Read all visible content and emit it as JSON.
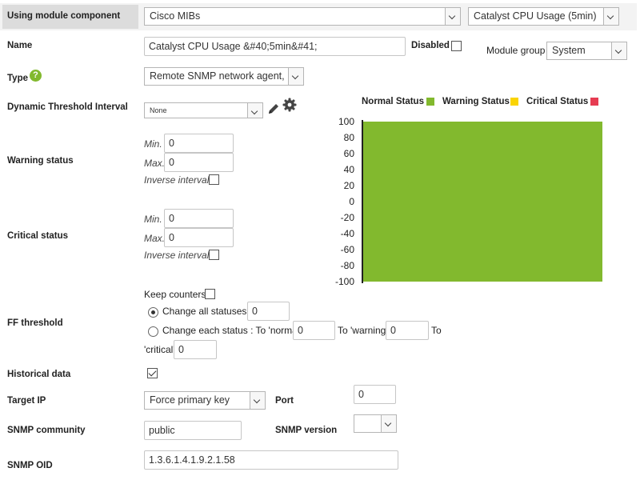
{
  "top": {
    "label": "Using module component",
    "component_group": "Cisco MIBs",
    "component": "Catalyst CPU Usage (5min)"
  },
  "name_row": {
    "label": "Name",
    "value": "Catalyst CPU Usage &#40;5min&#41;",
    "disabled_label": "Disabled",
    "module_group_label": "Module group",
    "module_group_value": "System"
  },
  "type_row": {
    "label": "Type",
    "value": "Remote SNMP network agent,"
  },
  "threshold_row": {
    "label": "Dynamic Threshold Interval",
    "value": "None"
  },
  "warning": {
    "label": "Warning status",
    "min_label": "Min.",
    "min_value": "0",
    "max_label": "Max.",
    "max_value": "0",
    "inverse_label": "Inverse interval"
  },
  "critical": {
    "label": "Critical status",
    "min_label": "Min.",
    "min_value": "0",
    "max_label": "Max.",
    "max_value": "0",
    "inverse_label": "Inverse interval"
  },
  "ff": {
    "label": "FF threshold",
    "keep_counters": "Keep counters",
    "change_all": "Change all statuses :",
    "change_all_value": "0",
    "change_each": "Change each status : To 'normal'",
    "normal_value": "0",
    "to_warning": "To 'warning'",
    "warning_value": "0",
    "to": "To",
    "critical_label": "'critical'",
    "critical_value": "0"
  },
  "historical": {
    "label": "Historical data",
    "checked": true
  },
  "target_ip": {
    "label": "Target IP",
    "value": "Force primary key"
  },
  "port": {
    "label": "Port",
    "value": "0"
  },
  "snmp_community": {
    "label": "SNMP community",
    "value": "public"
  },
  "snmp_version": {
    "label": "SNMP version",
    "value": ""
  },
  "snmp_oid": {
    "label": "SNMP OID",
    "value": "1.3.6.1.4.1.9.2.1.58"
  },
  "colors": {
    "normal": "#82b92e",
    "warning": "#fad403",
    "critical": "#e63c52"
  },
  "chart_data": {
    "type": "area",
    "legend": [
      {
        "name": "Normal Status",
        "color": "#82b92e"
      },
      {
        "name": "Warning Status",
        "color": "#fad403"
      },
      {
        "name": "Critical Status",
        "color": "#e63c52"
      }
    ],
    "legend_position": "top",
    "ylim": [
      -100,
      100
    ],
    "yticks": [
      "100",
      "80",
      "60",
      "40",
      "20",
      "0",
      "-20",
      "-40",
      "-60",
      "-80",
      "-100"
    ],
    "series": [
      {
        "name": "Normal Status",
        "range": [
          -100,
          100
        ]
      }
    ]
  }
}
